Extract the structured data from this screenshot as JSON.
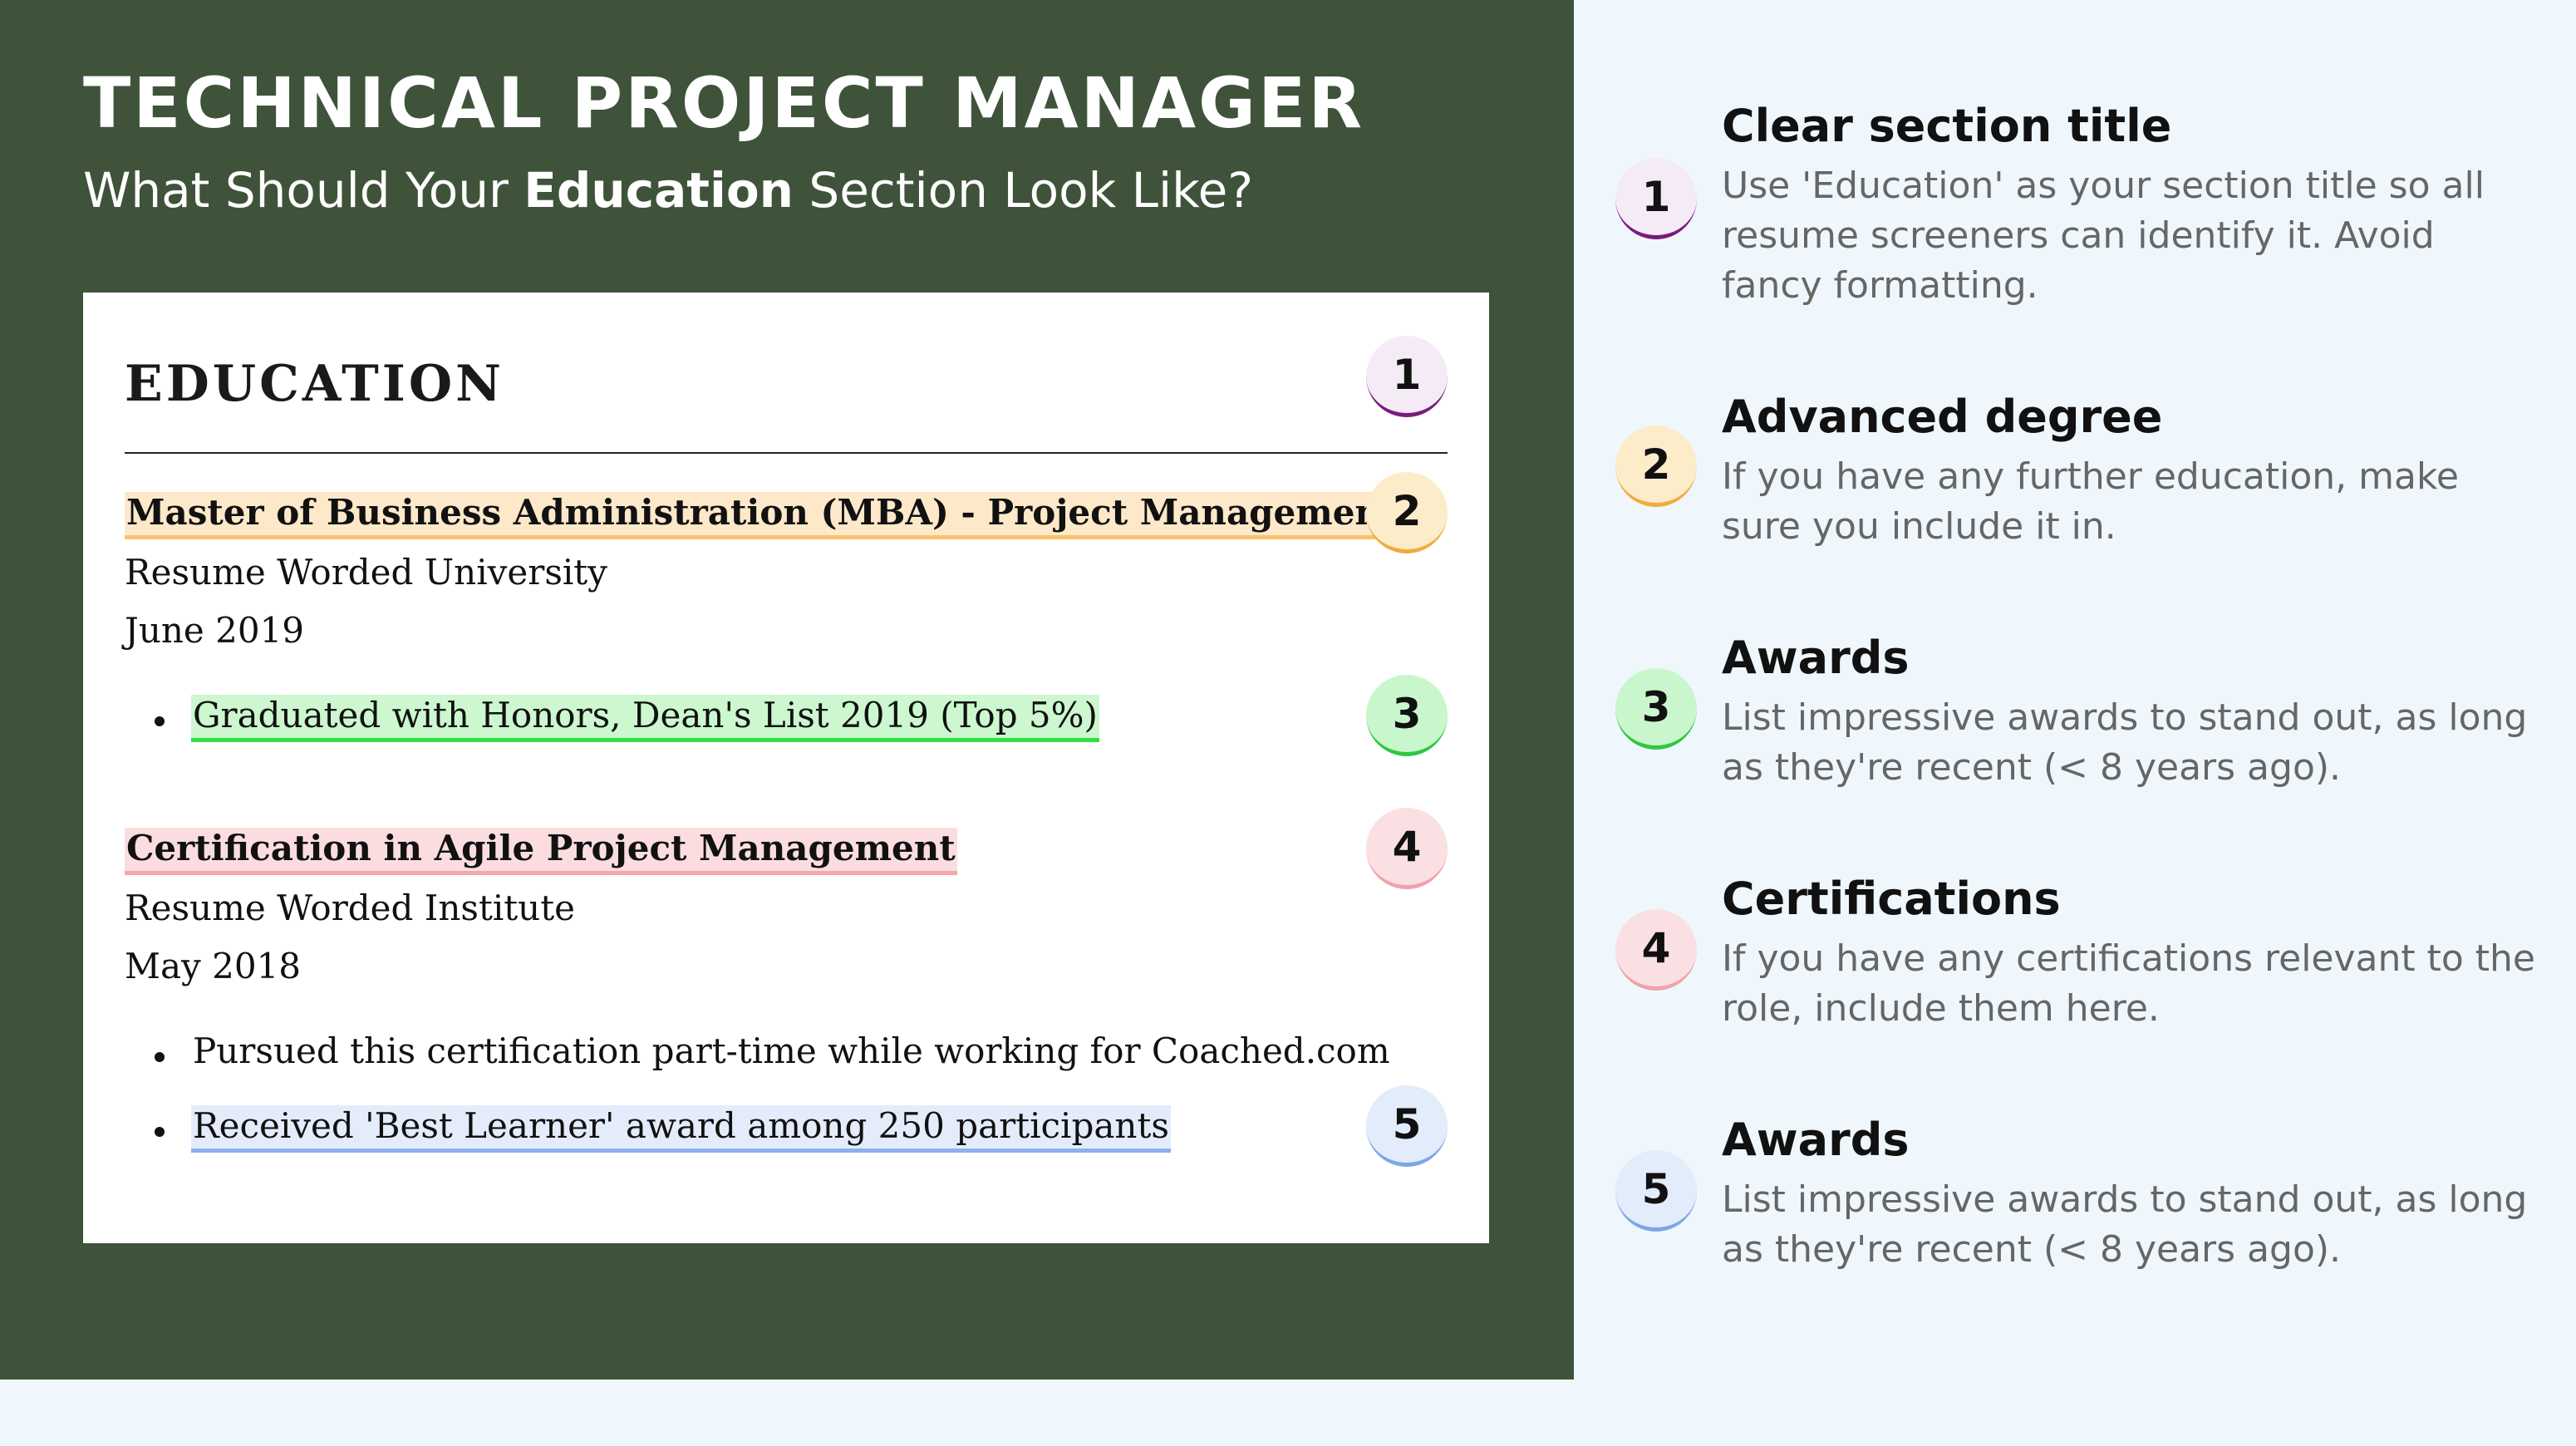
{
  "header": {
    "title": "TECHNICAL PROJECT MANAGER",
    "subtitle_prefix": "What Should Your ",
    "subtitle_bold": "Education",
    "subtitle_suffix": " Section Look Like?"
  },
  "resume": {
    "section_title": "EDUCATION",
    "entries": [
      {
        "degree": "Master of Business Administration (MBA) - Project Management",
        "school": "Resume Worded University",
        "date": "June 2019",
        "bullets": [
          "Graduated with Honors, Dean's List 2019 (Top 5%)"
        ]
      },
      {
        "degree": "Certification in Agile Project Management",
        "school": "Resume Worded Institute",
        "date": "May 2018",
        "bullets": [
          "Pursued this certification part-time while working for Coached.com",
          "Received 'Best Learner' award among 250 participants"
        ]
      }
    ],
    "badges": [
      "1",
      "2",
      "3",
      "4",
      "5"
    ]
  },
  "tips": [
    {
      "number": "1",
      "title": "Clear section title",
      "description": "Use 'Education' as your section title so all resume screeners can identify it. Avoid fancy formatting."
    },
    {
      "number": "2",
      "title": "Advanced degree",
      "description": "If you have any further education, make sure you include it in."
    },
    {
      "number": "3",
      "title": "Awards",
      "description": "List impressive awards to stand out, as long as they're recent (< 8 years ago)."
    },
    {
      "number": "4",
      "title": "Certifications",
      "description": "If you have any certifications relevant to the role, include them here."
    },
    {
      "number": "5",
      "title": "Awards",
      "description": "List impressive awards to stand out, as long as they're recent (< 8 years ago)."
    }
  ],
  "colors": {
    "dark_green": "#3f533b",
    "light_bg": "#eff7fd",
    "badge_1": "#7b1a7d",
    "badge_2": "#f0ad3c",
    "badge_3": "#2ec842",
    "badge_4": "#f0a2ab",
    "badge_5": "#7ea5e6"
  }
}
